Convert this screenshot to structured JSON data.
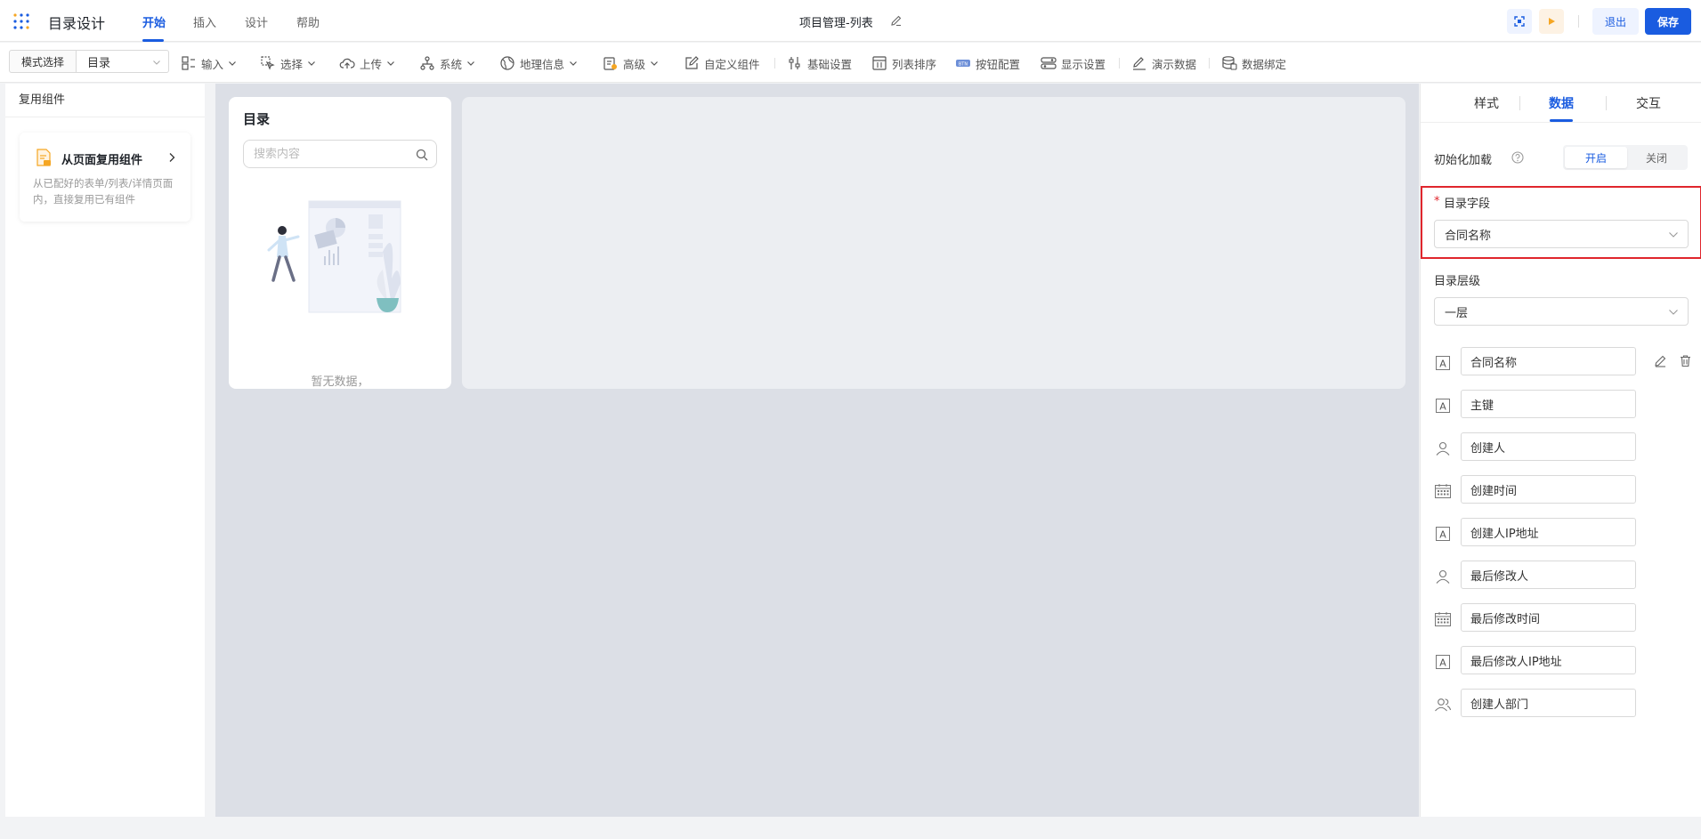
{
  "app": {
    "title": "目录设计",
    "tabs": [
      {
        "label": "开始",
        "active": true
      },
      {
        "label": "插入",
        "active": false
      },
      {
        "label": "设计",
        "active": false
      },
      {
        "label": "帮助",
        "active": false
      }
    ],
    "doc_title": "项目管理-列表",
    "exit_label": "退出",
    "save_label": "保存"
  },
  "toolbar": {
    "mode_label": "模式选择",
    "mode_value": "目录",
    "items": [
      {
        "label": "输入",
        "icon": "input-icon",
        "dropdown": true
      },
      {
        "label": "选择",
        "icon": "select-icon",
        "dropdown": true
      },
      {
        "label": "上传",
        "icon": "upload-cloud-icon",
        "dropdown": true
      },
      {
        "label": "系统",
        "icon": "system-icon",
        "dropdown": true
      },
      {
        "label": "地理信息",
        "icon": "globe-icon",
        "dropdown": true
      },
      {
        "label": "高级",
        "icon": "advanced-icon",
        "dropdown": true
      },
      {
        "label": "自定义组件",
        "icon": "custom-component-icon",
        "dropdown": false
      },
      {
        "label": "基础设置",
        "icon": "settings-sliders-icon",
        "dropdown": false
      },
      {
        "label": "列表排序",
        "icon": "sort-icon",
        "dropdown": false
      },
      {
        "label": "按钮配置",
        "icon": "button-config-icon",
        "dropdown": false
      },
      {
        "label": "显示设置",
        "icon": "display-icon",
        "dropdown": false
      },
      {
        "label": "演示数据",
        "icon": "demo-data-icon",
        "dropdown": false
      },
      {
        "label": "数据绑定",
        "icon": "database-icon",
        "dropdown": false
      }
    ]
  },
  "left_panel": {
    "header": "复用组件",
    "reuse_title": "从页面复用组件",
    "reuse_desc": "从已配好的表单/列表/详情页面内，直接复用已有组件"
  },
  "canvas": {
    "dir_title": "目录",
    "search_placeholder": "搜索内容",
    "empty_text": "暂无数据，"
  },
  "right_panel": {
    "tabs": [
      {
        "label": "样式",
        "active": false
      },
      {
        "label": "数据",
        "active": true
      },
      {
        "label": "交互",
        "active": false
      }
    ],
    "init_label": "初始化加载",
    "init_on": "开启",
    "init_off": "关闭",
    "dir_field_label": "目录字段",
    "dir_field_value": "合同名称",
    "level_label": "目录层级",
    "level_value": "一层",
    "fields": [
      {
        "label": "合同名称",
        "icon": "text-field-icon"
      },
      {
        "label": "主键",
        "icon": "text-field-icon"
      },
      {
        "label": "创建人",
        "icon": "user-icon"
      },
      {
        "label": "创建时间",
        "icon": "calendar-icon"
      },
      {
        "label": "创建人IP地址",
        "icon": "text-field-icon"
      },
      {
        "label": "最后修改人",
        "icon": "user-icon"
      },
      {
        "label": "最后修改时间",
        "icon": "calendar-icon"
      },
      {
        "label": "最后修改人IP地址",
        "icon": "text-field-icon"
      },
      {
        "label": "创建人部门",
        "icon": "department-icon"
      }
    ]
  },
  "colors": {
    "brand": "#1a5ce0",
    "highlight": "#e0262d"
  }
}
